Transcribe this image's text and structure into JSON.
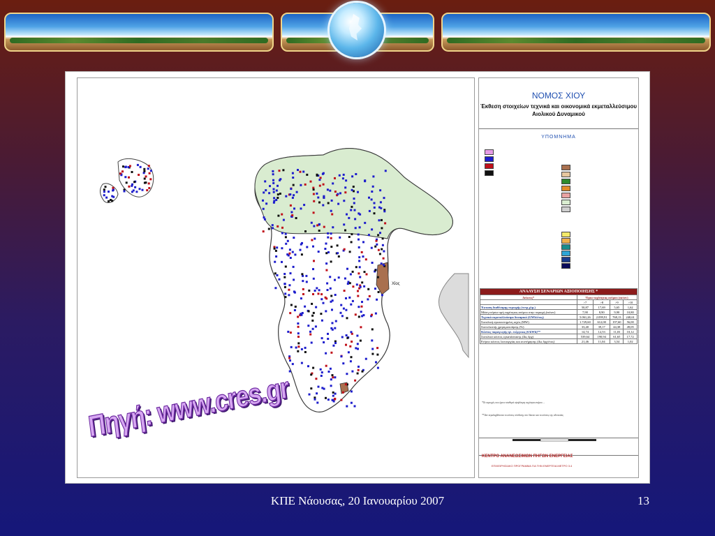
{
  "footer": {
    "text": "ΚΠΕ Νάουσας, 20 Ιανουαρίου 2007",
    "page_number": "13"
  },
  "source_label": "Πηγή: www.cres.gr",
  "map": {
    "title": "ΝΟΜΟΣ ΧΙΟΥ",
    "subtitle": "Έκθεση στοιχείων τεχνικά και οικονομικά εκμεταλλεύσιμου Αιολικού Δυναμικού",
    "legend_heading": "ΥΠΟΜΝΗΜΑ",
    "place_label": "Χίος",
    "table_title": "ΑΝΑΛΥΣΗ ΣΕΝΑΡΙΩΝ ΑΞΙΟΠΟΙΗΣΗΣ *",
    "table_col_label": "Δείκτες*",
    "table_range_header": "Όρια ταχύτητας ανέμου (m/sec)",
    "thresholds": [
      ">7",
      ">8",
      ">9",
      ">10"
    ],
    "rows": [
      {
        "label": "Έκταση διαθέσιμης περιοχής (τετρ.χλμ.)",
        "values": [
          "50,87",
          "17,69",
          "5,65",
          "1,62"
        ],
        "bold": true
      },
      {
        "label": "Μέση ετήσια τιμή ταχύτητας ανέμου στην περιοχή (m/sec)",
        "values": [
          "7,90",
          "8,90",
          "9,90",
          "10,80"
        ],
        "bold": false
      },
      {
        "label": "Τεχνικά εκμεταλλεύσιμο δυναμικό (GWh/έτος)",
        "values": [
          "5.061,26",
          "2.099,91",
          "768,13",
          "240,61"
        ],
        "bold": true
      },
      {
        "label": "Συνολική εγκατεστημένη ισχύς (MW)",
        "values": [
          "1.729,60",
          "612,00",
          "197,60",
          "56,00"
        ],
        "bold": false
      },
      {
        "label": "Συντελεστής χρησιμοποίησης (%)",
        "values": [
          "33,40",
          "39,17",
          "44,38",
          "49,05"
        ],
        "bold": false
      },
      {
        "label": "Κόστος παραγωγής ηλ. ενέργειας (€/kWh)**",
        "values": [
          "14,74",
          "12,53",
          "11,03",
          "10,12"
        ],
        "bold": true
      },
      {
        "label": "Συνολικό κόστος εγκατάστασης (Δις δρχ)",
        "values": [
          "539,64",
          "190,94",
          "61,65",
          "17,72"
        ],
        "bold": false
      },
      {
        "label": "Ετήσιο κόστος λειτουργίας και συντήρησης (Δις δρχ/έτος)",
        "values": [
          "21,46",
          "11,04",
          "3,54",
          "1,02"
        ],
        "bold": false
      }
    ],
    "note1": "*Οι περιοχές που έχουν σταθερά υψηλότερη ταχύτητα ανέμου ...",
    "note2": "**Δεν περιλαμβάνεται το κόστος σύνδεσης στο δίκτυο και το κόστος της οδοποιίας",
    "org_name": "ΚΕΝΤΡΟ ΑΝΑΝΕΩΣΙΜΩΝ ΠΗΓΩΝ ΕΝΕΡΓΕΙΑΣ",
    "org_program": "ΕΠΙΧΕΙΡΗΣΙΑΚΟ ΠΡΟΓΡΑΜΜΑ ΓΙΑ ΤΗΝ ΕΝΕΡΓΕΙΑ ΜΕΤΡΟ 3.4",
    "scale_labels": [
      "5000",
      "0",
      "5000",
      "10000",
      "15000 Meters"
    ],
    "colors": {
      "land_green": "#d9ecd0",
      "wind_blue": "#1d1dcc",
      "wind_red": "#c0101a",
      "wind_black": "#101010",
      "wind_pink": "#e69be6"
    }
  }
}
